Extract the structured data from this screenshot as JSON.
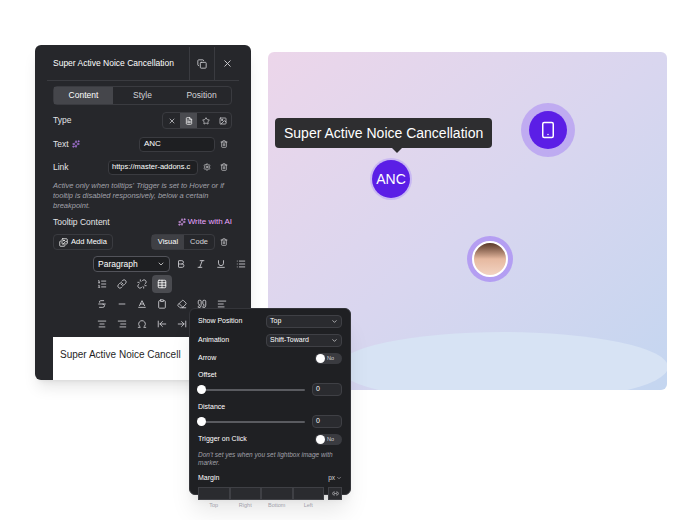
{
  "settings_panel": {
    "title": "Super Active Noice Cancellation",
    "tabs": [
      {
        "label": "Content",
        "selected": true
      },
      {
        "label": "Style",
        "selected": false
      },
      {
        "label": "Position",
        "selected": false
      }
    ],
    "type": {
      "label": "Type",
      "options": [
        {
          "selected": false
        },
        {
          "selected": true
        },
        {
          "selected": false
        },
        {
          "selected": false
        }
      ]
    },
    "text_field": {
      "label": "Text",
      "value": "ANC"
    },
    "link_field": {
      "label": "Link",
      "value": "https://master-addons.c"
    },
    "note": "Active only when tolltips' Trigger is set to Hover or if tooltip is disabled responsively, below a certain breakpoint.",
    "tooltip_content": {
      "label": "Tooltip Content",
      "ai_button": "Write with AI",
      "add_media": "Add Media",
      "editor_tabs": [
        {
          "label": "Visual",
          "selected": true
        },
        {
          "label": "Code",
          "selected": false
        }
      ],
      "format": "Paragraph",
      "toolbar": [
        {
          "selected": false
        },
        {
          "selected": false
        },
        {
          "selected": false
        },
        {
          "selected": false
        },
        {
          "selected": false
        },
        {
          "selected": false
        },
        {
          "selected": false
        },
        {
          "selected": true
        },
        {
          "selected": false
        },
        {
          "selected": false
        },
        {
          "selected": false
        },
        {
          "selected": false
        },
        {
          "selected": false
        },
        {
          "selected": false
        },
        {
          "selected": false
        },
        {
          "selected": false
        },
        {
          "selected": false
        },
        {
          "selected": false
        },
        {
          "selected": false
        },
        {
          "selected": false
        },
        {
          "selected": false
        },
        {
          "selected": false
        }
      ],
      "content": "Super Active Noice Cancell"
    }
  },
  "preview": {
    "tooltip": "Super Active Noice Cancellation",
    "hotspots": [
      {
        "kind": "text",
        "label": "ANC"
      },
      {
        "kind": "icon"
      },
      {
        "kind": "image"
      }
    ]
  },
  "popover": {
    "rows": [
      {
        "kind": "select",
        "label": "Show Position",
        "value": "Top"
      },
      {
        "kind": "select",
        "label": "Animation",
        "value": "Shift-Toward"
      },
      {
        "kind": "toggle",
        "label": "Arrow",
        "value": "No",
        "on": false
      },
      {
        "kind": "slider",
        "label": "Offset",
        "value": "0",
        "level": 0
      },
      {
        "kind": "slider",
        "label": "Distance",
        "value": "0",
        "level": 0
      },
      {
        "kind": "toggle",
        "label": "Trigger on Click",
        "value": "No",
        "on": false
      },
      {
        "kind": "note",
        "label": "Don't set yes when you set lightbox image with marker."
      },
      {
        "kind": "margin",
        "label": "Margin",
        "unit": "px",
        "sides": [
          "Top",
          "Right",
          "Bottom",
          "Left"
        ]
      }
    ]
  }
}
